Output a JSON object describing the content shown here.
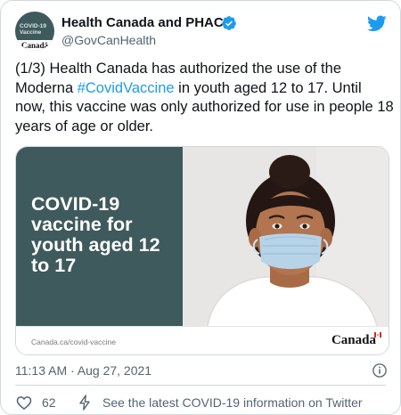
{
  "author": {
    "display_name": "Health Canada and PHAC",
    "handle": "@GovCanHealth",
    "avatar_text": "COVID-19 Vaccine",
    "avatar_wordmark": "Canadä"
  },
  "tweet": {
    "text_before": "(1/3) Health Canada has authorized the use of the Moderna ",
    "hashtag": "#CovidVaccine",
    "text_after": " in youth aged 12 to 17. Until now, this vaccine was only authorized for use in people 18 years of age or older."
  },
  "card": {
    "headline": "COVID-19 vaccine for youth aged 12 to 17",
    "url": "Canada.ca/covid-vaccine",
    "wordmark": "Canada"
  },
  "meta": {
    "timestamp": "11:13 AM · Aug 27, 2021"
  },
  "actions": {
    "like_count": "62",
    "info_link": "See the latest COVID-19 information on Twitter"
  },
  "colors": {
    "link": "#1d9bf0",
    "card_panel": "#3f5a5c",
    "secondary_text": "#536471"
  },
  "icons": [
    "verified-icon",
    "twitter-bird-icon",
    "info-icon",
    "heart-icon",
    "bolt-icon",
    "flag-icon"
  ]
}
